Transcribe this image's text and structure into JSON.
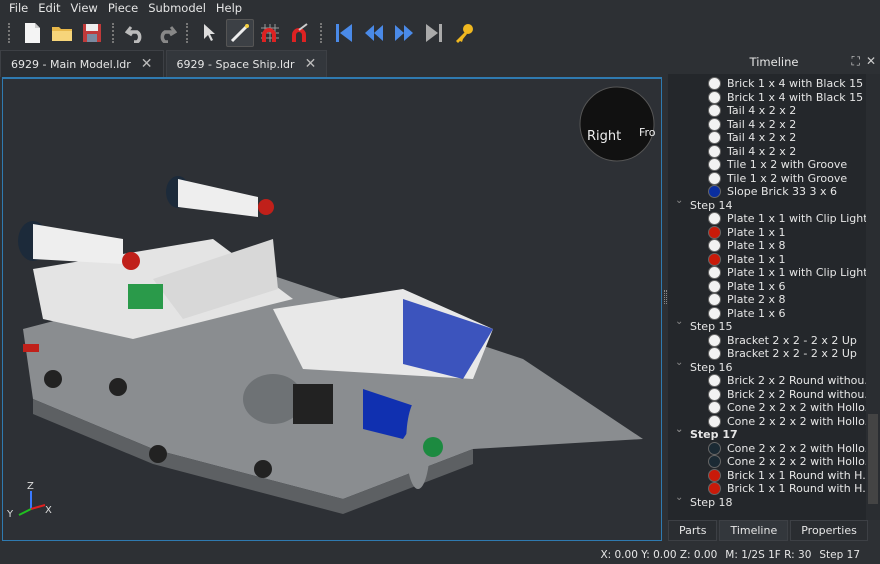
{
  "menu": [
    "File",
    "Edit",
    "View",
    "Piece",
    "Submodel",
    "Help"
  ],
  "toolbar": [
    "new-icon",
    "open-icon",
    "save-icon",
    "undo-icon",
    "redo-icon",
    "select-icon",
    "transform-xyz-icon",
    "snap-grid-icon",
    "snap-angle-icon",
    "first-step-icon",
    "previous-step-icon",
    "next-step-icon",
    "last-step-icon",
    "key-icon"
  ],
  "tabs": [
    {
      "label": "6929 - Main Model.ldr"
    },
    {
      "label": "6929 - Space Ship.ldr"
    }
  ],
  "viewsphere": {
    "right": "Right",
    "front": "Fro"
  },
  "axes": {
    "x": "X",
    "y": "Y",
    "z": "Z"
  },
  "panel": {
    "title": "Timeline"
  },
  "colors": {
    "white": "#f2f2f2",
    "red": "#c91a09",
    "blue": "#0a2ea0",
    "black": "#1b2a34"
  },
  "timeline": [
    {
      "type": "piece",
      "label": "Brick  1 x  4 with Black 15 ...",
      "color": "white"
    },
    {
      "type": "piece",
      "label": "Brick  1 x  4 with Black 15 ...",
      "color": "white"
    },
    {
      "type": "piece",
      "label": "Tail  4 x  2 x  2",
      "color": "white"
    },
    {
      "type": "piece",
      "label": "Tail  4 x  2 x  2",
      "color": "white"
    },
    {
      "type": "piece",
      "label": "Tail  4 x  2 x  2",
      "color": "white"
    },
    {
      "type": "piece",
      "label": "Tail  4 x  2 x  2",
      "color": "white"
    },
    {
      "type": "piece",
      "label": "Tile  1 x  2 with Groove",
      "color": "white"
    },
    {
      "type": "piece",
      "label": "Tile  1 x  2 with Groove",
      "color": "white"
    },
    {
      "type": "piece",
      "label": "Slope Brick 33  3 x  6",
      "color": "blue"
    },
    {
      "type": "step",
      "label": "Step 14"
    },
    {
      "type": "piece",
      "label": "Plate  1 x  1 with Clip Light...",
      "color": "white"
    },
    {
      "type": "piece",
      "label": "Plate  1 x  1",
      "color": "red"
    },
    {
      "type": "piece",
      "label": "Plate  1 x  8",
      "color": "white"
    },
    {
      "type": "piece",
      "label": "Plate  1 x  1",
      "color": "red"
    },
    {
      "type": "piece",
      "label": "Plate  1 x  1 with Clip Light...",
      "color": "white"
    },
    {
      "type": "piece",
      "label": "Plate  1 x  6",
      "color": "white"
    },
    {
      "type": "piece",
      "label": "Plate  2 x  8",
      "color": "white"
    },
    {
      "type": "piece",
      "label": "Plate  1 x  6",
      "color": "white"
    },
    {
      "type": "step",
      "label": "Step 15"
    },
    {
      "type": "piece",
      "label": "Bracket  2 x  2 -  2 x  2 Up",
      "color": "white"
    },
    {
      "type": "piece",
      "label": "Bracket  2 x  2 -  2 x  2 Up",
      "color": "white"
    },
    {
      "type": "step",
      "label": "Step 16"
    },
    {
      "type": "piece",
      "label": "Brick  2 x  2 Round withou...",
      "color": "white"
    },
    {
      "type": "piece",
      "label": "Brick  2 x  2 Round withou...",
      "color": "white"
    },
    {
      "type": "piece",
      "label": "Cone  2 x  2 x  2 with Hollo...",
      "color": "white"
    },
    {
      "type": "piece",
      "label": "Cone  2 x  2 x  2 with Hollo...",
      "color": "white"
    },
    {
      "type": "step",
      "label": "Step 17",
      "current": true
    },
    {
      "type": "piece",
      "label": "Cone  2 x  2 x  2 with Hollo...",
      "color": "black"
    },
    {
      "type": "piece",
      "label": "Cone  2 x  2 x  2 with Hollo...",
      "color": "black"
    },
    {
      "type": "piece",
      "label": "Brick  1 x  1 Round with H...",
      "color": "red"
    },
    {
      "type": "piece",
      "label": "Brick  1 x  1 Round with H...",
      "color": "red"
    },
    {
      "type": "step",
      "label": "Step 18"
    }
  ],
  "panel_tabs": [
    {
      "label": "Parts"
    },
    {
      "label": "Timeline",
      "selected": true
    },
    {
      "label": "Properties"
    }
  ],
  "status": {
    "coords": "X: 0.00 Y: 0.00 Z: 0.00",
    "info": "M: 1/2S 1F R: 30",
    "step": "Step 17"
  }
}
